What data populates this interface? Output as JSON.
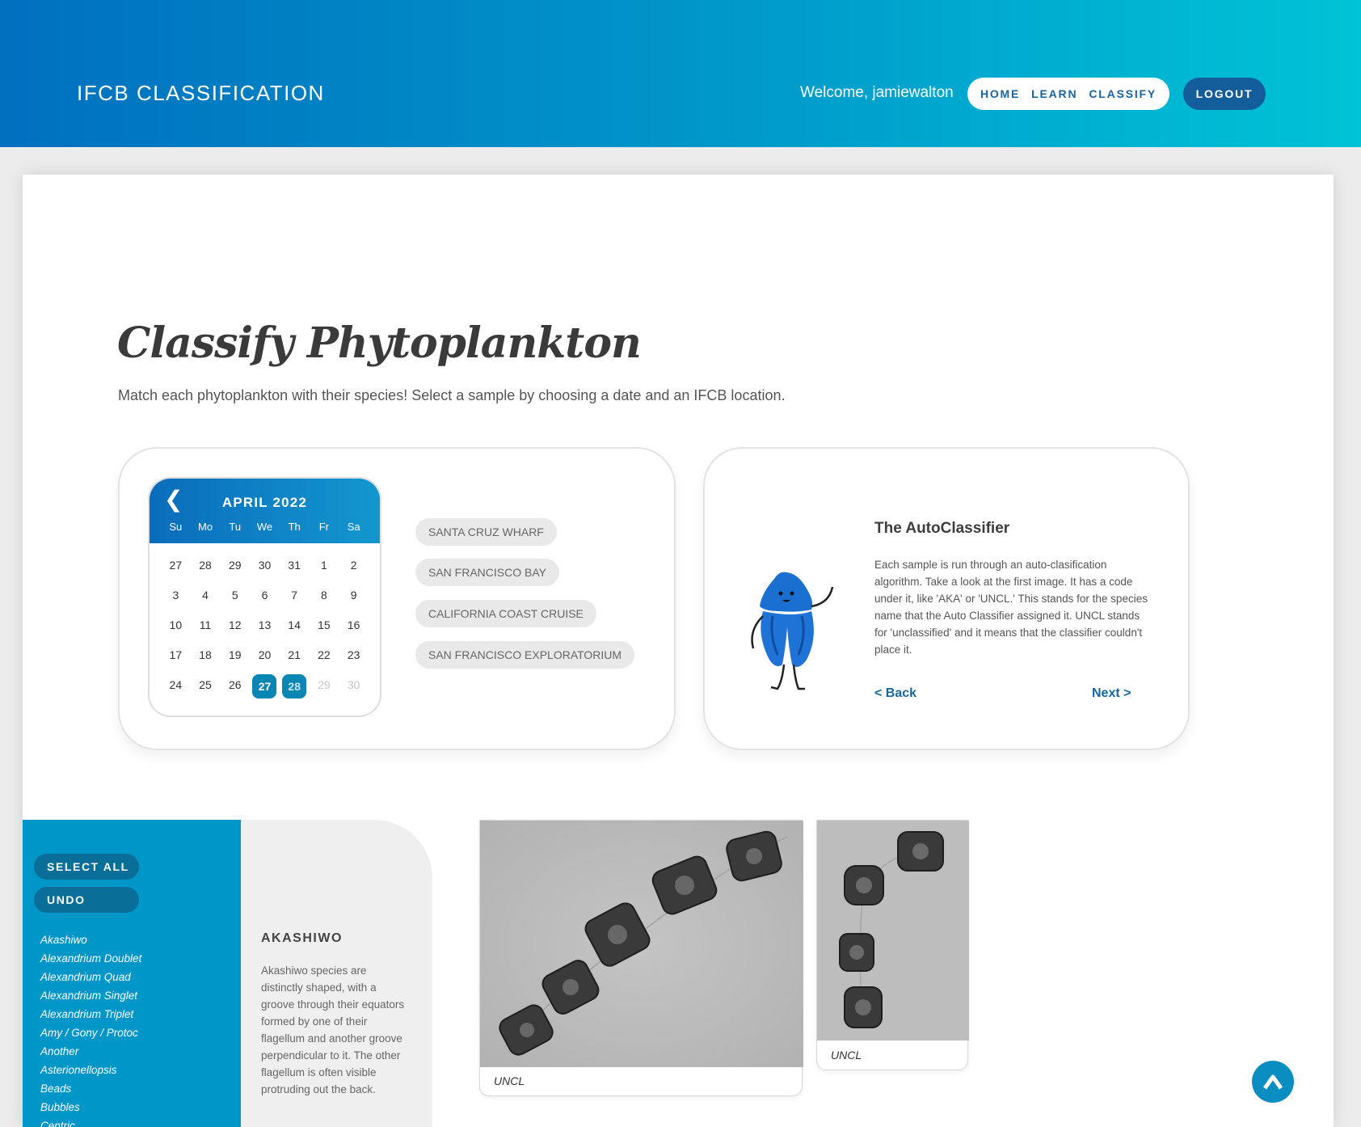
{
  "header": {
    "brand": "IFCB CLASSIFICATION",
    "welcome": "Welcome, jamiewalton",
    "nav": [
      "HOME",
      "LEARN",
      "CLASSIFY"
    ],
    "logout": "LOGOUT"
  },
  "page": {
    "title": "Classify Phytoplankton",
    "subtitle": "Match each phytoplankton with their species! Select a sample by choosing a date and an IFCB location."
  },
  "calendar": {
    "prev_icon": "chevron-left-icon",
    "month": "APRIL 2022",
    "weekdays": [
      "Su",
      "Mo",
      "Tu",
      "We",
      "Th",
      "Fr",
      "Sa"
    ],
    "days": [
      "27",
      "28",
      "29",
      "30",
      "31",
      "1",
      "2",
      "3",
      "4",
      "5",
      "6",
      "7",
      "8",
      "9",
      "10",
      "11",
      "12",
      "13",
      "14",
      "15",
      "16",
      "17",
      "18",
      "19",
      "20",
      "21",
      "22",
      "23",
      "24",
      "25",
      "26",
      "27",
      "28",
      "29",
      "30"
    ],
    "selected": [
      "27",
      "28"
    ],
    "disabled": [
      "29",
      "30"
    ]
  },
  "locations": [
    "SANTA CRUZ WHARF",
    "SAN FRANCISCO BAY",
    "CALIFORNIA COAST CRUISE",
    "SAN FRANCISCO EXPLORATORIUM"
  ],
  "autoclassifier": {
    "title": "The AutoClassifier",
    "text": "Each sample is run through an auto-clasification algorithm. Take a look at the first image. It has a code under it, like 'AKA' or 'UNCL.' This stands for the species name that the Auto Classifier assigned it. UNCL stands for 'unclassified' and it means that the classifier couldn't place it.",
    "back": "< Back",
    "next": "Next >"
  },
  "sidebar": {
    "select_all": "SELECT ALL",
    "undo": "UNDO",
    "species": [
      "Akashiwo",
      "Alexandrium Doublet",
      "Alexandrium Quad",
      "Alexandrium Singlet",
      "Alexandrium Triplet",
      "Amy / Gony / Protoc",
      "Another",
      "Asterionellopsis",
      "Beads",
      "Bubbles",
      "Centric"
    ]
  },
  "species_info": {
    "title": "AKASHIWO",
    "text": "Akashiwo species are distinctly shaped, with a groove through their equators formed by one of their flagellum and another groove perpendicular to it. The other flagellum is often visible protruding out the back."
  },
  "images": [
    {
      "caption": "UNCL"
    },
    {
      "caption": "UNCL"
    }
  ],
  "colors": {
    "accent": "#0096c7",
    "header_start": "#0070bf",
    "header_end": "#00c3d6",
    "link": "#15669f"
  }
}
